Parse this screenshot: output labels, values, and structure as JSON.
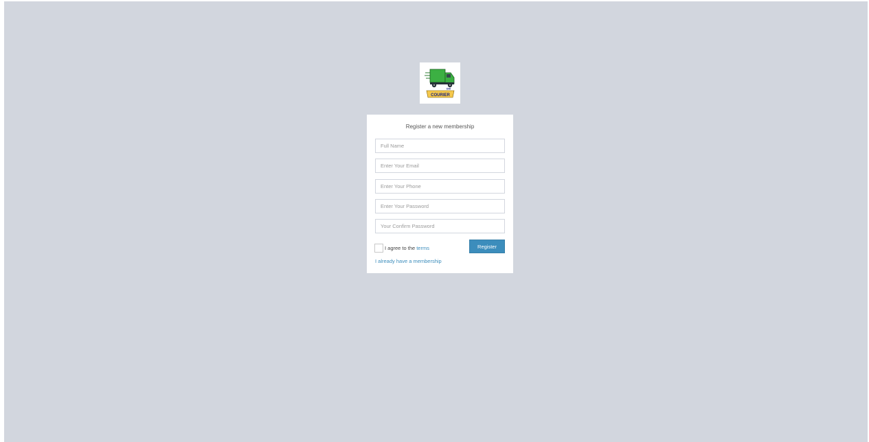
{
  "logo": {
    "text": "COURIER",
    "small_text": "DHI"
  },
  "form": {
    "title": "Register a new membership",
    "fields": {
      "full_name": {
        "placeholder": "Full Name",
        "value": ""
      },
      "email": {
        "placeholder": "Enter Your Email",
        "value": ""
      },
      "phone": {
        "placeholder": "Enter Your Phone",
        "value": ""
      },
      "password": {
        "placeholder": "Enter Your Password",
        "value": ""
      },
      "confirm_password": {
        "placeholder": "Your Confirm Password",
        "value": ""
      }
    },
    "agree_text": "I agree to the",
    "terms_link": "terms",
    "agree_checked": false,
    "register_label": "Register",
    "login_link": "I already have a membership"
  },
  "colors": {
    "background": "#d2d6de",
    "accent": "#3c8dbc",
    "truck_green": "#3cb043"
  }
}
